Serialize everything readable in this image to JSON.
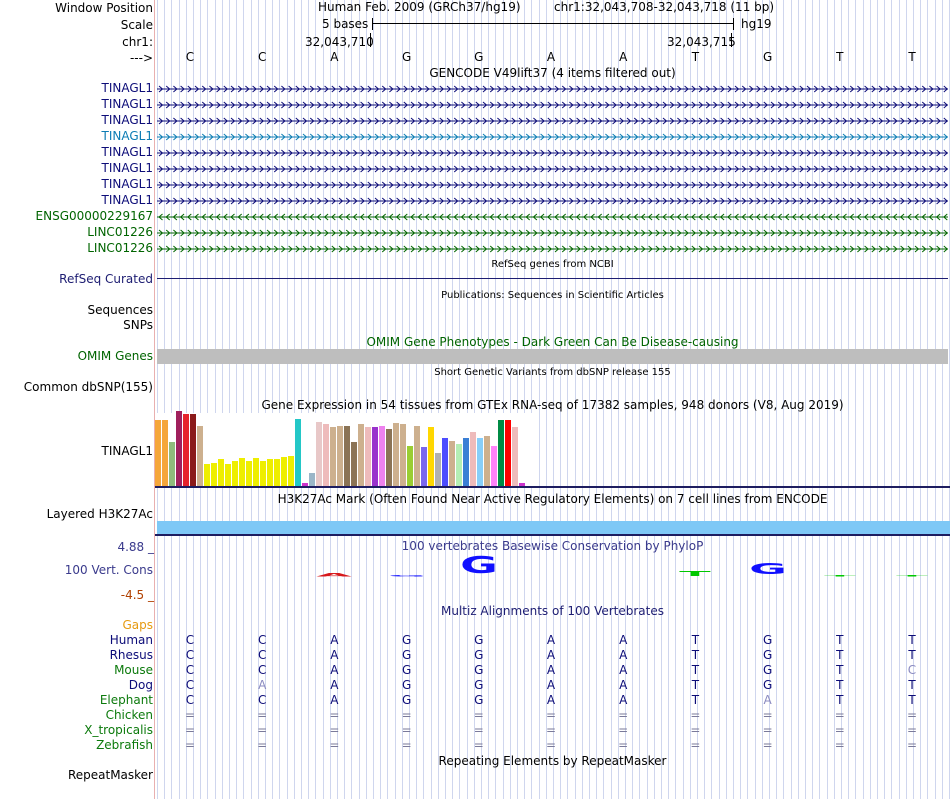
{
  "header": {
    "window_position_label": "Window Position",
    "scale_label": "Scale",
    "chrom_label": "chr1:",
    "strand_label": "--->",
    "assembly_title": "Human Feb. 2009 (GRCh37/hg19)",
    "position_text": "chr1:32,043,708-32,043,718 (11 bp)",
    "scale_text": "5 bases",
    "db_label": "hg19",
    "coord_left": "32,043,710",
    "coord_right": "32,043,715",
    "bases": [
      "C",
      "C",
      "A",
      "G",
      "G",
      "A",
      "A",
      "T",
      "G",
      "T",
      "T"
    ]
  },
  "gencode": {
    "title": "GENCODE V49lift37 (4 items filtered out)",
    "rows": [
      {
        "label": "TINAGL1",
        "color": "#0c0c78",
        "direction": "forward"
      },
      {
        "label": "TINAGL1",
        "color": "#0c0c78",
        "direction": "forward"
      },
      {
        "label": "TINAGL1",
        "color": "#0c0c78",
        "direction": "forward"
      },
      {
        "label": "TINAGL1",
        "color": "#0c7cb4",
        "direction": "forward"
      },
      {
        "label": "TINAGL1",
        "color": "#0c0c78",
        "direction": "forward"
      },
      {
        "label": "TINAGL1",
        "color": "#0c0c78",
        "direction": "forward"
      },
      {
        "label": "TINAGL1",
        "color": "#0c0c78",
        "direction": "forward"
      },
      {
        "label": "TINAGL1",
        "color": "#0c0c78",
        "direction": "forward"
      },
      {
        "label": "ENSG00000229167",
        "color": "#006400",
        "direction": "reverse"
      },
      {
        "label": "LINC01226",
        "color": "#006400",
        "direction": "forward"
      },
      {
        "label": "LINC01226",
        "color": "#006400",
        "direction": "forward"
      }
    ]
  },
  "refseq": {
    "title": "RefSeq genes from NCBI",
    "label": "RefSeq Curated"
  },
  "publications": {
    "title": "Publications: Sequences in Scientific Articles",
    "label1": "Sequences",
    "label2": "SNPs"
  },
  "omim": {
    "title": "OMIM Gene Phenotypes - Dark Green Can Be Disease-causing",
    "label": "OMIM Genes"
  },
  "dbsnp": {
    "title": "Short Genetic Variants from dbSNP release 155",
    "label": "Common dbSNP(155)"
  },
  "gtex": {
    "title": "Gene Expression in 54 tissues from GTEx RNA-seq of 17382 samples, 948 donors (V8, Aug 2019)",
    "label": "TINAGL1",
    "bars": [
      {
        "v": 0.98,
        "c": "#f5a63a"
      },
      {
        "v": 0.98,
        "c": "#f5a63a"
      },
      {
        "v": 0.65,
        "c": "#8fbb7c"
      },
      {
        "v": 1.12,
        "c": "#a0205c"
      },
      {
        "v": 1.08,
        "c": "#e6242c"
      },
      {
        "v": 1.08,
        "c": "#8b1a1a"
      },
      {
        "v": 0.9,
        "c": "#cdb08e"
      },
      {
        "v": 0.33,
        "c": "#eeee00"
      },
      {
        "v": 0.35,
        "c": "#eeee00"
      },
      {
        "v": 0.4,
        "c": "#eeee00"
      },
      {
        "v": 0.33,
        "c": "#eeee00"
      },
      {
        "v": 0.38,
        "c": "#eeee00"
      },
      {
        "v": 0.42,
        "c": "#eeee00"
      },
      {
        "v": 0.38,
        "c": "#eeee00"
      },
      {
        "v": 0.42,
        "c": "#eeee00"
      },
      {
        "v": 0.37,
        "c": "#eeee00"
      },
      {
        "v": 0.4,
        "c": "#eeee00"
      },
      {
        "v": 0.4,
        "c": "#eeee00"
      },
      {
        "v": 0.43,
        "c": "#eeee00"
      },
      {
        "v": 0.45,
        "c": "#eeee00"
      },
      {
        "v": 1.0,
        "c": "#23c7c7"
      },
      {
        "v": 0.05,
        "c": "#cc33cc"
      },
      {
        "v": 0.2,
        "c": "#9ab6c8"
      },
      {
        "v": 0.96,
        "c": "#e8c8c8"
      },
      {
        "v": 0.92,
        "c": "#eebbbb"
      },
      {
        "v": 0.88,
        "c": "#cdb08e"
      },
      {
        "v": 0.9,
        "c": "#cdb08e"
      },
      {
        "v": 0.9,
        "c": "#8b7355"
      },
      {
        "v": 0.65,
        "c": "#8b7355"
      },
      {
        "v": 0.92,
        "c": "#cdb08e"
      },
      {
        "v": 0.88,
        "c": "#eebbbb"
      },
      {
        "v": 0.88,
        "c": "#9932cc"
      },
      {
        "v": 0.9,
        "c": "#ee82ee"
      },
      {
        "v": 0.85,
        "c": "#8b7355"
      },
      {
        "v": 0.94,
        "c": "#cdb08e"
      },
      {
        "v": 0.92,
        "c": "#cdb08e"
      },
      {
        "v": 0.6,
        "c": "#9acd32"
      },
      {
        "v": 0.9,
        "c": "#cdb08e"
      },
      {
        "v": 0.58,
        "c": "#7a67ee"
      },
      {
        "v": 0.88,
        "c": "#ffd700"
      },
      {
        "v": 0.5,
        "c": "#b0b0b0"
      },
      {
        "v": 0.72,
        "c": "#4d4dff"
      },
      {
        "v": 0.67,
        "c": "#cdb08e"
      },
      {
        "v": 0.62,
        "c": "#b4eeb4"
      },
      {
        "v": 0.72,
        "c": "#3a7fd5"
      },
      {
        "v": 0.8,
        "c": "#eebbbb"
      },
      {
        "v": 0.72,
        "c": "#87cefa"
      },
      {
        "v": 0.75,
        "c": "#cdb08e"
      },
      {
        "v": 0.6,
        "c": "#ff83fa"
      },
      {
        "v": 0.98,
        "c": "#008b45"
      },
      {
        "v": 0.98,
        "c": "#ff0000"
      },
      {
        "v": 0.88,
        "c": "#eebbbb"
      },
      {
        "v": 0.05,
        "c": "#cc33cc"
      }
    ]
  },
  "h3k27ac": {
    "title": "H3K27Ac Mark (Often Found Near Active Regulatory Elements) on 7 cell lines from ENCODE",
    "label": "Layered H3K27Ac",
    "color": "#7ec8f6"
  },
  "phylop": {
    "title": "100 vertebrates Basewise Conservation by PhyloP",
    "label": "100 Vert. Cons",
    "max": "4.88 _",
    "min": "-4.5 _",
    "scores": [
      -0.5,
      -0.5,
      0.6,
      0.3,
      3.3,
      -0.2,
      -0.3,
      1.0,
      2.1,
      0.3,
      0
    ],
    "title_color": "#3a3a8c",
    "max_color": "#3a3a8c",
    "min_color": "#b04000"
  },
  "multiz": {
    "title": "Multiz Alignments of 100 Vertebrates",
    "gaps_label": "Gaps",
    "rows": [
      {
        "species": "Human",
        "color": "#0c0c78",
        "bases": [
          "C",
          "C",
          "A",
          "G",
          "G",
          "A",
          "A",
          "T",
          "G",
          "T",
          "T"
        ]
      },
      {
        "species": "Rhesus",
        "color": "#0c0c78",
        "bases": [
          "C",
          "C",
          "A",
          "G",
          "G",
          "A",
          "A",
          "T",
          "G",
          "T",
          "T"
        ]
      },
      {
        "species": "Mouse",
        "color": "#0c7a0c",
        "bases": [
          "C",
          "C",
          "A",
          "G",
          "G",
          "A",
          "A",
          "T",
          "G",
          "T",
          "C"
        ]
      },
      {
        "species": "Dog",
        "color": "#0c0c78",
        "bases": [
          "C",
          "A",
          "A",
          "G",
          "G",
          "A",
          "A",
          "T",
          "G",
          "T",
          "T"
        ]
      },
      {
        "species": "Elephant",
        "color": "#0c7a0c",
        "bases": [
          "C",
          "C",
          "A",
          "G",
          "G",
          "A",
          "A",
          "T",
          "A",
          "T",
          "T"
        ]
      },
      {
        "species": "Chicken",
        "color": "#0c7a0c",
        "bases": [
          "=",
          "=",
          "=",
          "=",
          "=",
          "=",
          "=",
          "=",
          "=",
          "=",
          "="
        ]
      },
      {
        "species": "X_tropicalis",
        "color": "#0c7a0c",
        "bases": [
          "=",
          "=",
          "=",
          "=",
          "=",
          "=",
          "=",
          "=",
          "=",
          "=",
          "="
        ]
      },
      {
        "species": "Zebrafish",
        "color": "#0c7a0c",
        "bases": [
          "=",
          "=",
          "=",
          "=",
          "=",
          "=",
          "=",
          "=",
          "=",
          "=",
          "="
        ]
      }
    ],
    "dim_cells": [
      "3-1",
      "2-10",
      "4-8"
    ]
  },
  "repeatmasker": {
    "title": "Repeating Elements by RepeatMasker",
    "label": "RepeatMasker"
  }
}
